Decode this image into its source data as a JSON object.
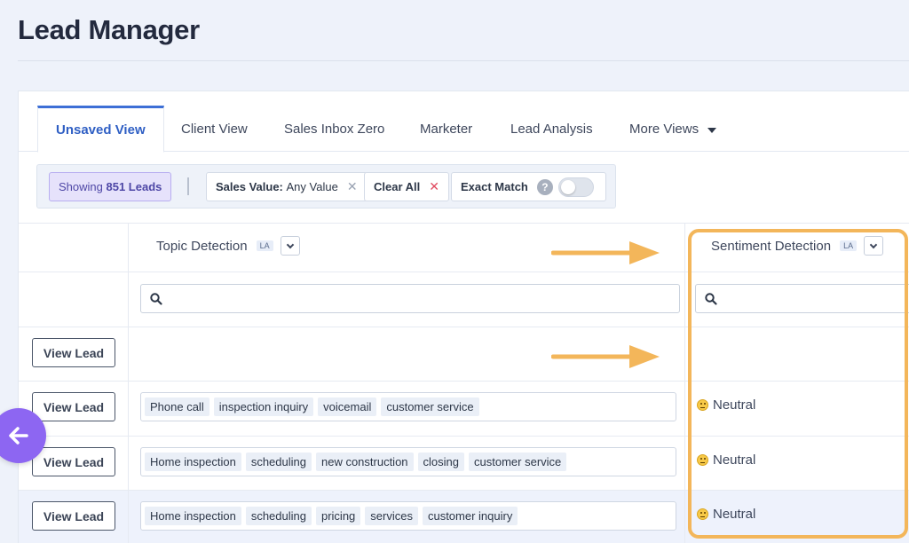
{
  "page": {
    "title": "Lead Manager"
  },
  "tabs": [
    {
      "label": "Unsaved View",
      "active": true
    },
    {
      "label": "Client View"
    },
    {
      "label": "Sales Inbox Zero"
    },
    {
      "label": "Marketer"
    },
    {
      "label": "Lead Analysis"
    },
    {
      "label": "More Views"
    }
  ],
  "filters": {
    "showing_prefix": "Showing",
    "showing_count": "851 Leads",
    "sales_value_label": "Sales Value:",
    "sales_value_value": "Any Value",
    "clear_all": "Clear All",
    "exact_match": "Exact Match",
    "help_glyph": "?",
    "exact_match_on": false
  },
  "columns": {
    "topic": {
      "label": "Topic Detection",
      "badge": "LA"
    },
    "sentiment": {
      "label": "Sentiment Detection",
      "badge": "LA"
    }
  },
  "search": {
    "topic_value": "",
    "sentiment_value": ""
  },
  "rows": [
    {
      "button": "View Lead",
      "tags": [],
      "sentiment": ""
    },
    {
      "button": "View Lead",
      "tags": [
        "Phone call",
        "inspection inquiry",
        "voicemail",
        "customer service"
      ],
      "sentiment": "Neutral"
    },
    {
      "button": "View Lead",
      "tags": [
        "Home inspection",
        "scheduling",
        "new construction",
        "closing",
        "customer service"
      ],
      "sentiment": "Neutral"
    },
    {
      "button": "View Lead",
      "tags": [
        "Home inspection",
        "scheduling",
        "pricing",
        "services",
        "customer inquiry"
      ],
      "sentiment": "Neutral"
    }
  ],
  "colors": {
    "accent": "#3d6fd6",
    "highlight": "#f3b65a",
    "fab": "#8d66f2",
    "selected_row": "#eef2fc"
  },
  "icons": [
    "search-icon",
    "chevron-down-icon",
    "close-icon",
    "help-icon",
    "neutral-face-icon",
    "arrow-left-icon",
    "arrow-right-icon"
  ]
}
